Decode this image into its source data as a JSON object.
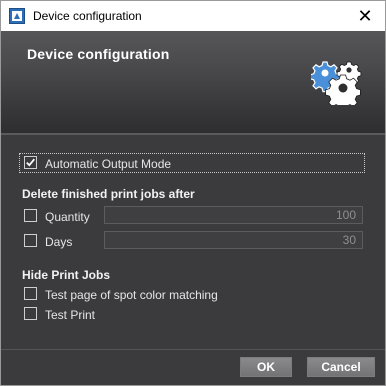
{
  "window": {
    "title": "Device configuration",
    "close_glyph": "✕"
  },
  "banner": {
    "title": "Device configuration",
    "icon": "gears-icon"
  },
  "automatic_output": {
    "label": "Automatic Output Mode",
    "checked": true
  },
  "delete_section": {
    "heading": "Delete finished print jobs after",
    "quantity": {
      "label": "Quantity",
      "checked": false,
      "value": "100"
    },
    "days": {
      "label": "Days",
      "checked": false,
      "value": "30"
    }
  },
  "hide_section": {
    "heading": "Hide Print Jobs",
    "items": [
      {
        "label": "Test page of spot color matching",
        "checked": false
      },
      {
        "label": "Test Print",
        "checked": false
      }
    ]
  },
  "footer": {
    "ok_label": "OK",
    "cancel_label": "Cancel"
  },
  "colors": {
    "background": "#3b3b3d",
    "text": "#e6e6e6",
    "gear_blue": "#4a90d9"
  }
}
